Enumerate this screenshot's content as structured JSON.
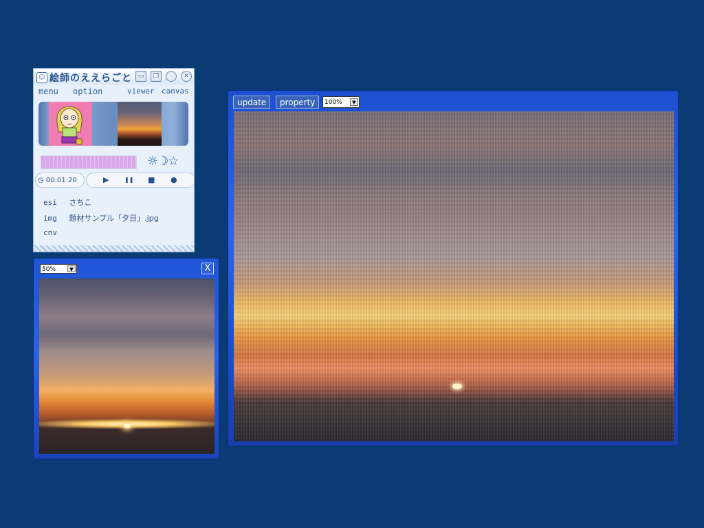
{
  "control_window": {
    "title": "絵師のええらごと",
    "menu": {
      "menu": "menu",
      "option": "option",
      "viewer": "viewer",
      "canvas": "canvas"
    },
    "weather_icons": "☼☽☆",
    "time": "00:01:20",
    "transport": {
      "play": "▶",
      "pause": "❚❚",
      "stop": "■",
      "record": "●"
    },
    "info": [
      {
        "key": "esi",
        "value": "さちこ"
      },
      {
        "key": "img",
        "value": "題材サンプル「夕日」.jpg"
      },
      {
        "key": "cnv",
        "value": ""
      }
    ]
  },
  "viewer_window": {
    "zoom": "50%",
    "close_label": "X"
  },
  "canvas_window": {
    "update_label": "update",
    "property_label": "property",
    "zoom": "100%"
  },
  "colors": {
    "desktop": "#0a3b74",
    "window_blue": "#2a63e6",
    "control_bg": "#e8f1fb"
  }
}
